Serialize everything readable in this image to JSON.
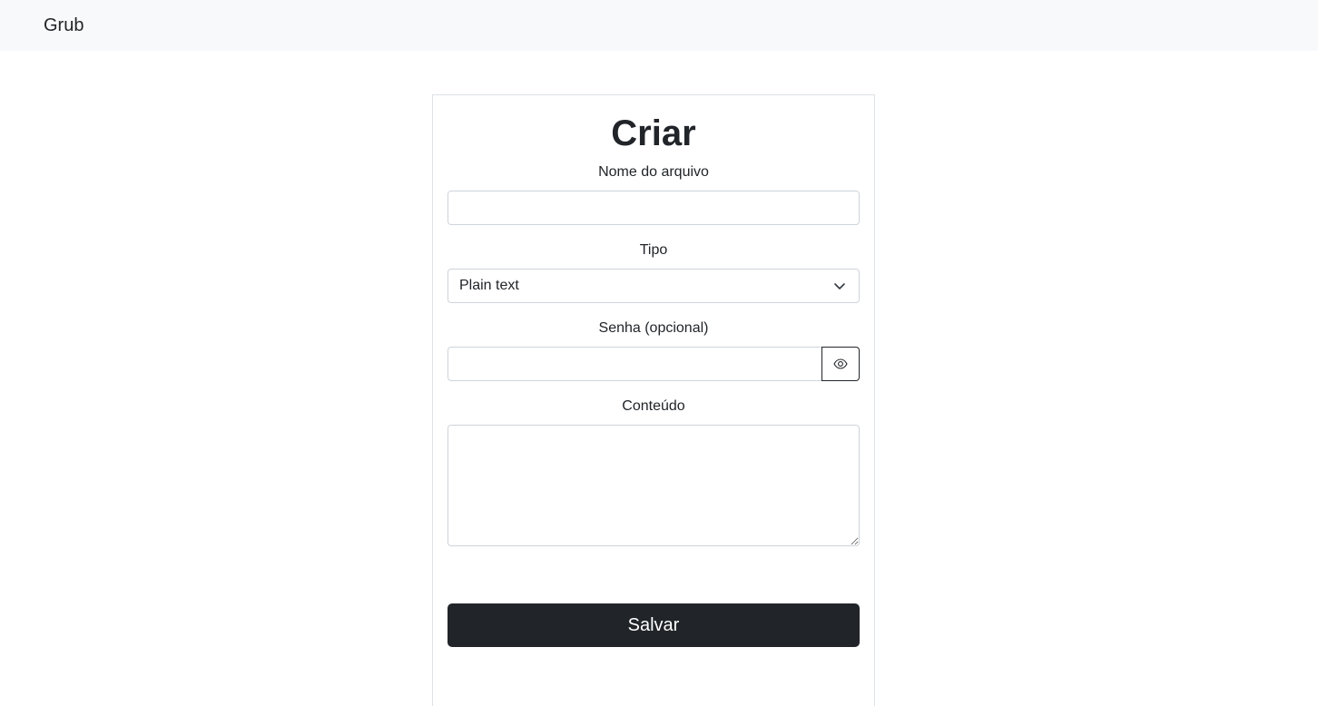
{
  "navbar": {
    "brand": "Grub"
  },
  "form": {
    "title": "Criar",
    "filename": {
      "label": "Nome do arquivo",
      "value": "",
      "placeholder": ""
    },
    "type": {
      "label": "Tipo",
      "selected": "Plain text"
    },
    "password": {
      "label": "Senha (opcional)",
      "value": "",
      "placeholder": "",
      "toggle_icon": "eye-icon"
    },
    "content": {
      "label": "Conteúdo",
      "value": "",
      "placeholder": ""
    },
    "save_label": "Salvar"
  },
  "colors": {
    "navbar_bg": "#f8f9fa",
    "button_bg": "#212529",
    "button_text": "#ffffff",
    "border": "#ced4da"
  }
}
